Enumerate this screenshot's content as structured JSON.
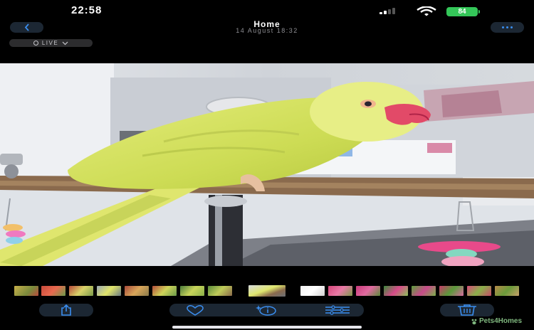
{
  "status_bar": {
    "time": "22:58",
    "battery_level": "84",
    "battery_color": "#34c759"
  },
  "header": {
    "back_icon": "chevron-left-icon",
    "title": "Home",
    "subtitle": "14 August  18:32",
    "more_icon": "ellipsis-icon",
    "live_label": "LIVE",
    "accent_color": "#3a8ef0"
  },
  "photo": {
    "subject": "parrot-photo"
  },
  "thumbnails": {
    "selected_index": 8,
    "count": 18
  },
  "toolbar": {
    "share_icon": "share-icon",
    "favorite_icon": "heart-icon",
    "info_icon": "info-sparkle-icon",
    "adjust_icon": "sliders-icon",
    "delete_icon": "trash-icon"
  },
  "watermark": {
    "text": "Pets4Homes"
  }
}
